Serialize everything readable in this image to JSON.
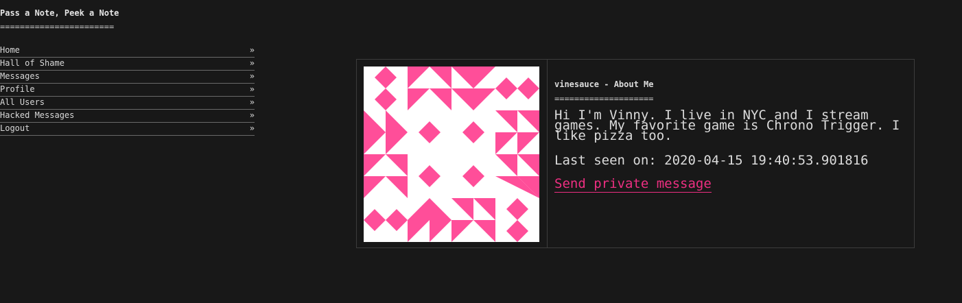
{
  "site": {
    "title": "Pass a Note, Peek a Note",
    "underline": "======================="
  },
  "nav": {
    "arrow": "»",
    "items": [
      {
        "label": "Home"
      },
      {
        "label": "Hall of Shame"
      },
      {
        "label": "Messages"
      },
      {
        "label": "Profile"
      },
      {
        "label": "All Users"
      },
      {
        "label": "Hacked Messages"
      },
      {
        "label": "Logout"
      }
    ]
  },
  "profile": {
    "title": "vinesauce - About Me",
    "underline": "=======================",
    "bio": "Hi I'm Vinny. I live in NYC and I stream games. My favorite game is Chrono Trigger. I like pizza too.",
    "last_seen": "Last seen on: 2020-04-15 19:40:53.901816",
    "send_message_label": "Send private message",
    "avatar_icon": "identicon-pink-geometric"
  },
  "colors": {
    "background": "#181818",
    "accent": "#ee2f82",
    "identicon": "#ff4e99"
  }
}
